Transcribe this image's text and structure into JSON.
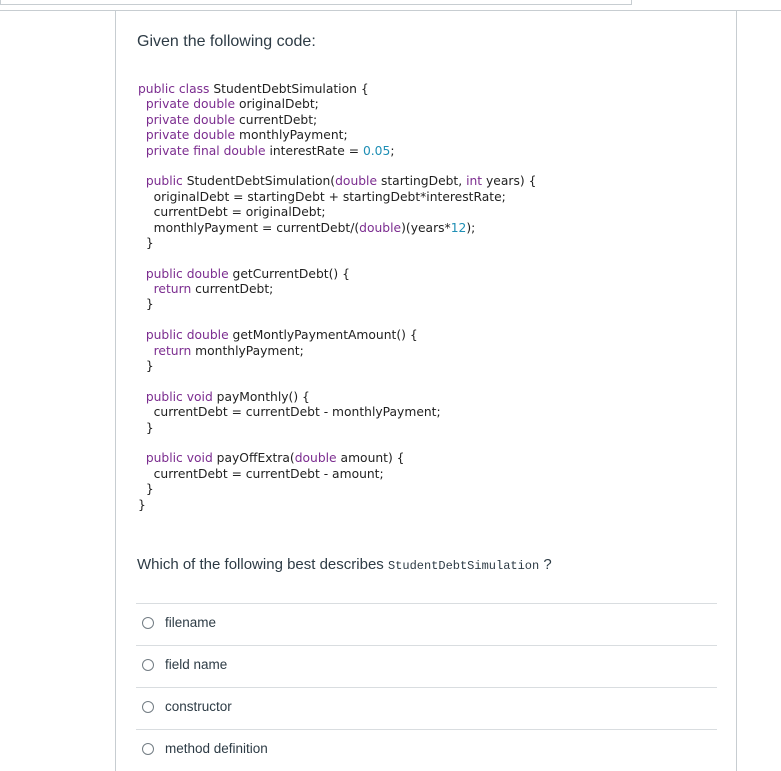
{
  "question": {
    "prompt": "Given the following code:",
    "code_lines": [
      [
        {
          "t": "public class ",
          "c": "kw"
        },
        {
          "t": "StudentDebtSimulation {",
          "c": ""
        }
      ],
      [
        {
          "t": "  private double ",
          "c": "kw"
        },
        {
          "t": "originalDebt;",
          "c": ""
        }
      ],
      [
        {
          "t": "  private double ",
          "c": "kw"
        },
        {
          "t": "currentDebt;",
          "c": ""
        }
      ],
      [
        {
          "t": "  private double ",
          "c": "kw"
        },
        {
          "t": "monthlyPayment;",
          "c": ""
        }
      ],
      [
        {
          "t": "  private final double ",
          "c": "kw"
        },
        {
          "t": "interestRate = ",
          "c": ""
        },
        {
          "t": "0.05",
          "c": "num"
        },
        {
          "t": ";",
          "c": ""
        }
      ],
      [],
      [
        {
          "t": "  public ",
          "c": "kw"
        },
        {
          "t": "StudentDebtSimulation(",
          "c": ""
        },
        {
          "t": "double ",
          "c": "kw"
        },
        {
          "t": "startingDebt, ",
          "c": ""
        },
        {
          "t": "int ",
          "c": "kw"
        },
        {
          "t": "years) {",
          "c": ""
        }
      ],
      [
        {
          "t": "    originalDebt = startingDebt + startingDebt*interestRate;",
          "c": ""
        }
      ],
      [
        {
          "t": "    currentDebt = originalDebt;",
          "c": ""
        }
      ],
      [
        {
          "t": "    monthlyPayment = currentDebt/(",
          "c": ""
        },
        {
          "t": "double",
          "c": "kw"
        },
        {
          "t": ")(years*",
          "c": ""
        },
        {
          "t": "12",
          "c": "num"
        },
        {
          "t": ");",
          "c": ""
        }
      ],
      [
        {
          "t": "  }",
          "c": ""
        }
      ],
      [],
      [
        {
          "t": "  public double ",
          "c": "kw"
        },
        {
          "t": "getCurrentDebt() {",
          "c": ""
        }
      ],
      [
        {
          "t": "    return ",
          "c": "kw"
        },
        {
          "t": "currentDebt;",
          "c": ""
        }
      ],
      [
        {
          "t": "  }",
          "c": ""
        }
      ],
      [],
      [
        {
          "t": "  public double ",
          "c": "kw"
        },
        {
          "t": "getMontlyPaymentAmount() {",
          "c": ""
        }
      ],
      [
        {
          "t": "    return ",
          "c": "kw"
        },
        {
          "t": "monthlyPayment;",
          "c": ""
        }
      ],
      [
        {
          "t": "  }",
          "c": ""
        }
      ],
      [],
      [
        {
          "t": "  public void ",
          "c": "kw"
        },
        {
          "t": "payMonthly() {",
          "c": ""
        }
      ],
      [
        {
          "t": "    currentDebt = currentDebt - monthlyPayment;",
          "c": ""
        }
      ],
      [
        {
          "t": "  }",
          "c": ""
        }
      ],
      [],
      [
        {
          "t": "  public void ",
          "c": "kw"
        },
        {
          "t": "payOffExtra(",
          "c": ""
        },
        {
          "t": "double ",
          "c": "kw"
        },
        {
          "t": "amount) {",
          "c": ""
        }
      ],
      [
        {
          "t": "    currentDebt = currentDebt - amount;",
          "c": ""
        }
      ],
      [
        {
          "t": "  }",
          "c": ""
        }
      ],
      [
        {
          "t": "}",
          "c": ""
        }
      ]
    ],
    "text_before": "Which of the following best describes ",
    "code_term": "StudentDebtSimulation",
    "text_after": " ?"
  },
  "answers": [
    {
      "label": "filename"
    },
    {
      "label": "field name"
    },
    {
      "label": "constructor"
    },
    {
      "label": "method definition"
    }
  ]
}
